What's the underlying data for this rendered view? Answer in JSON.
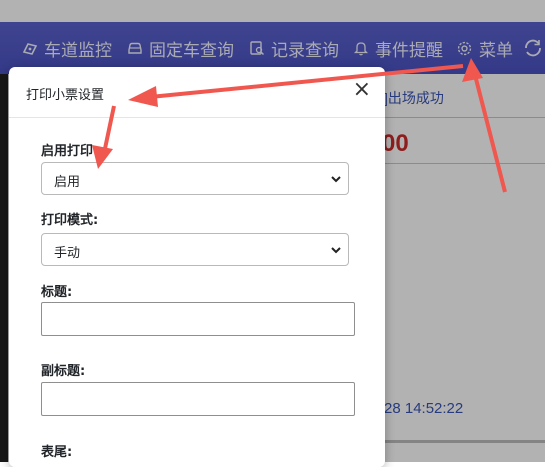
{
  "nav": {
    "items": [
      {
        "label": "车道监控",
        "icon": "car-lane-icon"
      },
      {
        "label": "固定车查询",
        "icon": "car-icon"
      },
      {
        "label": "记录查询",
        "icon": "document-search-icon"
      },
      {
        "label": "事件提醒",
        "icon": "bell-icon"
      },
      {
        "label": "菜单",
        "icon": "gear-icon"
      }
    ],
    "refresh_icon": "refresh-icon"
  },
  "background": {
    "status_text": "]出场成功",
    "amount_text": "00",
    "timestamp": "28 14:52:22"
  },
  "modal": {
    "title": "打印小票设置",
    "close_symbol": "×",
    "fields": {
      "enable_print": {
        "label": "启用打印",
        "value": "启用"
      },
      "print_mode": {
        "label": "打印模式:",
        "value": "手动"
      },
      "title_field": {
        "label": "标题:",
        "value": ""
      },
      "subtitle_field": {
        "label": "副标题:",
        "value": ""
      },
      "footer_field": {
        "label": "表尾:"
      }
    }
  },
  "colors": {
    "navbar": "#5059c8",
    "annotation_arrow": "#f0574f",
    "amount_red": "#cc2a2a",
    "status_blue": "#3a55b5"
  }
}
